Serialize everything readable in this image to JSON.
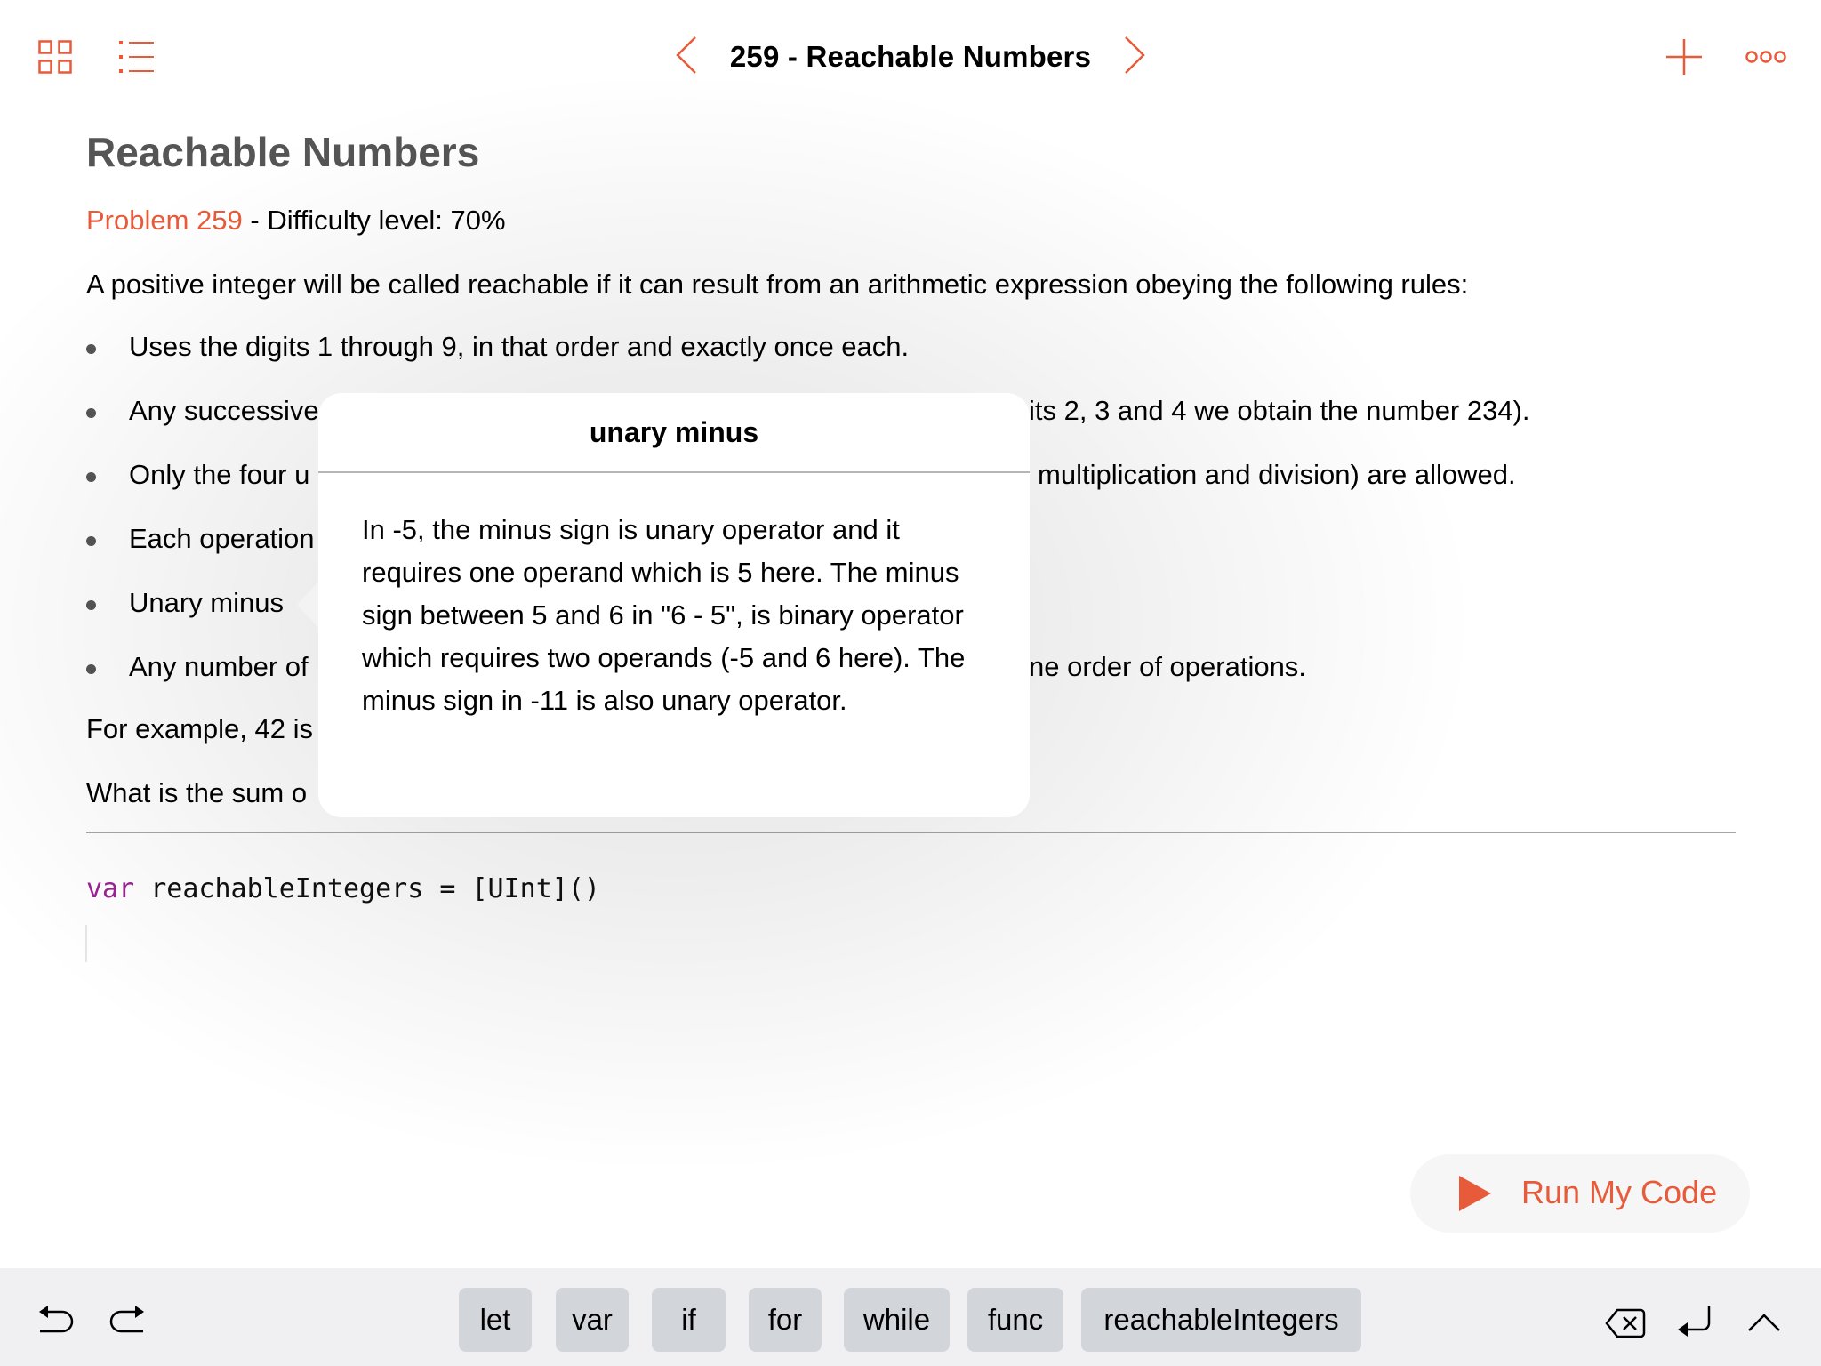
{
  "nav": {
    "title": "259 - Reachable Numbers",
    "left_icons": [
      "grid-icon",
      "list-icon"
    ],
    "right_icons": [
      "plus-icon",
      "more-icon"
    ],
    "prev_icon": "chevron-left-icon",
    "next_icon": "chevron-right-icon"
  },
  "colors": {
    "accent": "#E85B3A",
    "heading": "#555555",
    "keyword": "#9b2393",
    "bar_background": "#f0f0f2",
    "key_background": "#d2d5da"
  },
  "content": {
    "heading": "Reachable Numbers",
    "problem_link": "Problem 259",
    "difficulty": " - Difficulty level: 70%",
    "intro": "A positive integer will be called reachable if it can result from an arithmetic expression obeying the following rules:",
    "bullets": [
      {
        "left": "Uses the digits 1 through 9, in that order and exactly once each.",
        "right": ""
      },
      {
        "left": "Any successive",
        "right": "its 2, 3 and 4 we obtain the number 234)."
      },
      {
        "left": "Only the four u",
        "right": "multiplication and division) are allowed."
      },
      {
        "left": "Each operation",
        "right": ""
      },
      {
        "left": "Unary minus",
        "right": ""
      },
      {
        "left": "Any number of",
        "right": "ne order of operations."
      }
    ],
    "example_line": "For example, 42 is",
    "question_line": "What is the sum o"
  },
  "code": {
    "keyword": "var",
    "rest": " reachableIntegers = [UInt]()"
  },
  "popover": {
    "title": "unary minus",
    "body": "In -5, the minus sign is unary operator and it requires one operand which is 5 here. The minus sign between 5 and 6 in \"6 - 5\", is binary operator which requires two operands (-5 and 6 here). The minus sign in -11 is also unary operator."
  },
  "run_button": {
    "label": "Run My Code",
    "icon": "play-icon"
  },
  "bottom_bar": {
    "left_icons": [
      "undo-icon",
      "redo-icon"
    ],
    "keys": [
      "let",
      "var",
      "if",
      "for",
      "while",
      "func",
      "reachableIntegers"
    ],
    "right_icons": [
      "delete-icon",
      "return-icon",
      "hide-keyboard-icon"
    ]
  }
}
